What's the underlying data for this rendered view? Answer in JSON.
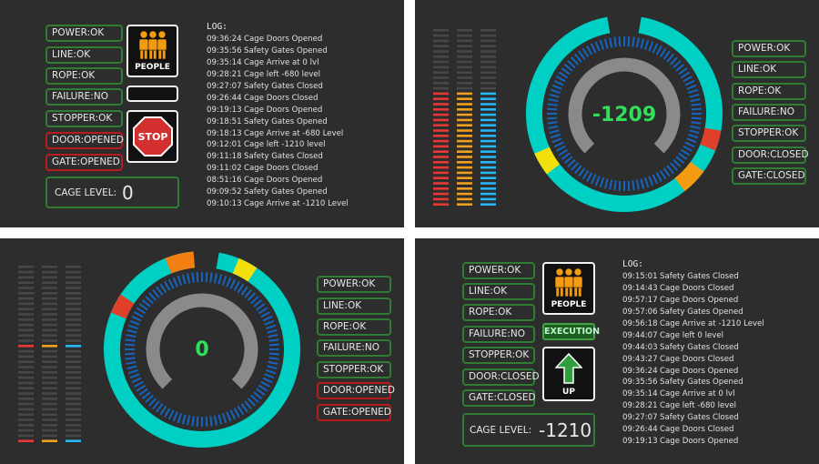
{
  "colors": {
    "ok_border": "#2e7d32",
    "alarm_border": "#b71c1c",
    "panel_bg": "#2d2d2d",
    "dial_ring": "#00cfc4",
    "dial_ticks": "#1565c0",
    "gauge_value": "#2ee05a"
  },
  "panel_a": {
    "status": [
      "POWER:OK",
      "LINE:OK",
      "ROPE:OK",
      "FAILURE:NO",
      "STOPPER:OK",
      "DOOR:OPENED",
      "GATE:OPENED"
    ],
    "status_alarm": [
      false,
      false,
      false,
      false,
      false,
      true,
      true
    ],
    "people_label": "PEOPLE",
    "people_icon": "people-icon",
    "stop_label": "STOP",
    "stop_icon": "stop-sign-icon",
    "cage_label": "CAGE LEVEL:",
    "cage_value": "0",
    "log_title": "LOG:",
    "log": [
      {
        "time": "09:36:24",
        "msg": "Cage Doors Opened"
      },
      {
        "time": "09:35:56",
        "msg": "Safety Gates Opened"
      },
      {
        "time": "09:35:14",
        "msg": "Cage Arrive at 0 lvl"
      },
      {
        "time": "09:28:21",
        "msg": "Cage left -680 level"
      },
      {
        "time": "09:27:07",
        "msg": "Safety Gates Closed"
      },
      {
        "time": "09:26:44",
        "msg": "Cage Doors Closed"
      },
      {
        "time": "09:19:13",
        "msg": "Cage Doors Opened"
      },
      {
        "time": "09:18:51",
        "msg": "Safety Gates Opened"
      },
      {
        "time": "09:18:13",
        "msg": "Cage Arrive at -680 Level"
      },
      {
        "time": "09:12:01",
        "msg": "Cage left -1210 level"
      },
      {
        "time": "09:11:18",
        "msg": "Safety Gates Closed"
      },
      {
        "time": "09:11:02",
        "msg": "Cage Doors Closed"
      },
      {
        "time": "08:51:16",
        "msg": "Cage Doors Opened"
      },
      {
        "time": "09:09:52",
        "msg": "Safety Gates Opened"
      },
      {
        "time": "09:10:13",
        "msg": "Cage Arrive at -1210 Level"
      }
    ]
  },
  "panel_b": {
    "gauge_value": "-1209",
    "status": [
      "POWER:OK",
      "LINE:OK",
      "ROPE:OK",
      "FAILURE:NO",
      "STOPPER:OK",
      "DOOR:CLOSED",
      "GATE:CLOSED"
    ],
    "status_alarm": [
      false,
      false,
      false,
      false,
      false,
      false,
      false
    ],
    "bars": [
      {
        "color": "#e53935",
        "level": 0.52
      },
      {
        "color": "#f0a020",
        "level": 0.52
      },
      {
        "color": "#29b6f6",
        "level": 0.52
      }
    ]
  },
  "panel_c": {
    "gauge_value": "0",
    "status": [
      "POWER:OK",
      "LINE:OK",
      "ROPE:OK",
      "FAILURE:NO",
      "STOPPER:OK",
      "DOOR:OPENED",
      "GATE:OPENED"
    ],
    "status_alarm": [
      false,
      false,
      false,
      false,
      false,
      true,
      true
    ],
    "bars": [
      {
        "color": "#e53935",
        "level": 0.0
      },
      {
        "color": "#f0a020",
        "level": 0.0
      },
      {
        "color": "#29b6f6",
        "level": 0.0
      }
    ]
  },
  "panel_d": {
    "status": [
      "POWER:OK",
      "LINE:OK",
      "ROPE:OK",
      "FAILURE:NO",
      "STOPPER:OK",
      "DOOR:CLOSED",
      "GATE:CLOSED"
    ],
    "status_alarm": [
      false,
      false,
      false,
      false,
      false,
      false,
      false
    ],
    "people_label": "PEOPLE",
    "people_icon": "people-icon",
    "execution_label": "EXECUTION",
    "up_label": "UP",
    "up_icon": "arrow-up-icon",
    "cage_label": "CAGE LEVEL:",
    "cage_value": "-1210",
    "log_title": "LOG:",
    "log": [
      {
        "time": "09:15:01",
        "msg": "Safety Gates Closed"
      },
      {
        "time": "09:14:43",
        "msg": "Cage Doors Closed"
      },
      {
        "time": "09:57:17",
        "msg": "Cage Doors Opened"
      },
      {
        "time": "09:57:06",
        "msg": "Safety Gates Opened"
      },
      {
        "time": "09:56:18",
        "msg": "Cage Arrive at -1210 Level"
      },
      {
        "time": "09:44:07",
        "msg": "Cage left 0 level"
      },
      {
        "time": "09:44:03",
        "msg": "Safety Gates Closed"
      },
      {
        "time": "09:43:27",
        "msg": "Cage Doors Closed"
      },
      {
        "time": "09:36:24",
        "msg": "Cage Doors Opened"
      },
      {
        "time": "09:35:56",
        "msg": "Safety Gates Opened"
      },
      {
        "time": "09:35:14",
        "msg": "Cage Arrive at 0 lvl"
      },
      {
        "time": "09:28:21",
        "msg": "Cage left -680 level"
      },
      {
        "time": "09:27:07",
        "msg": "Safety Gates Closed"
      },
      {
        "time": "09:26:44",
        "msg": "Cage Doors Closed"
      },
      {
        "time": "09:19:13",
        "msg": "Cage Doors Opened"
      }
    ]
  }
}
